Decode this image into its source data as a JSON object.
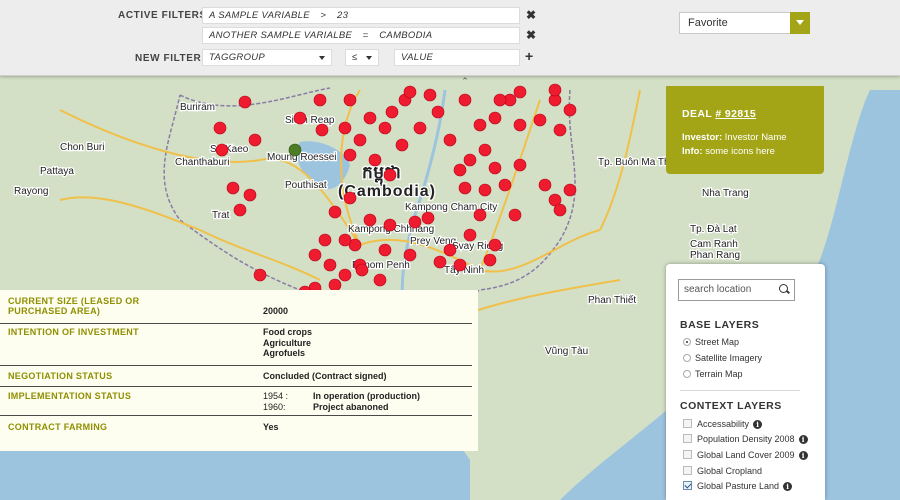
{
  "filters": {
    "active_label": "ACTIVE FILTERS",
    "new_label": "NEW FILTER",
    "active": [
      {
        "variable": "A SAMPLE VARIABLE",
        "operator": ">",
        "value": "23"
      },
      {
        "variable": "ANOTHER SAMPLE VARIALBE",
        "operator": "=",
        "value": "CAMBODIA"
      }
    ],
    "new": {
      "variable": "TAGGROUP",
      "operator": "≤",
      "value": "VALUE"
    },
    "remove_symbol": "✖",
    "add_symbol": "+",
    "collapse_symbol": "⌃"
  },
  "favorite": {
    "selected": "Favorite"
  },
  "deal": {
    "title_prefix": "DEAL",
    "number": "# 92815",
    "investor_label": "Investor:",
    "investor_value": "Investor Name",
    "info_label": "Info:",
    "info_value": "some icons here"
  },
  "details": [
    {
      "key": "CURRENT SIZE (LEASED OR PURCHASED AREA)",
      "values": [
        "20000"
      ]
    },
    {
      "key": "INTENTION OF INVESTMENT",
      "values": [
        "Food crops",
        "Agriculture",
        "Agrofuels"
      ]
    },
    {
      "key": "NEGOTIATION STATUS",
      "values": [
        "Concluded (Contract signed)"
      ]
    },
    {
      "key": "IMPLEMENTATION STATUS",
      "timeline": [
        {
          "year": "1954 :",
          "status": "In operation (production)"
        },
        {
          "year": "1960:",
          "status": "Project abanoned"
        }
      ]
    },
    {
      "key": "CONTRACT FARMING",
      "values": [
        "Yes"
      ]
    }
  ],
  "layers": {
    "search_placeholder": "search location",
    "base_title": "BASE LAYERS",
    "base": [
      {
        "label": "Street Map",
        "selected": true
      },
      {
        "label": "Satellite Imagery",
        "selected": false
      },
      {
        "label": "Terrain Map",
        "selected": false
      }
    ],
    "context_title": "CONTEXT LAYERS",
    "context": [
      {
        "label": "Accessability",
        "checked": false
      },
      {
        "label": "Population Density 2008",
        "checked": false
      },
      {
        "label": "Global Land Cover 2009",
        "checked": false
      },
      {
        "label": "Global Cropland",
        "checked": false
      },
      {
        "label": "Global Pasture Land",
        "checked": true
      }
    ],
    "info_glyph": "i"
  },
  "map": {
    "colors": {
      "land": "#d3e0c6",
      "water": "#9dc4df",
      "marker": "#ee1c2e",
      "selected_marker": "#4f7d25",
      "road": "#f0c04a",
      "border": "#8a7aa6"
    },
    "labels": {
      "country_native": "កម្ពុជា",
      "country": "(Cambodia)",
      "places": [
        "Siem Reap",
        "Moung Roessei",
        "Chanthaburi",
        "Rayong",
        "Trat",
        "Pouthisat",
        "Kampong Chhnang",
        "Kampong Cham City",
        "Prey Veng",
        "Svay Rieng",
        "Tây Ninh",
        "Phnom Penh",
        "Tp. Buôn Ma Thuột",
        "Tp. Đà Lạt",
        "Nha Trang",
        "Phan Rang",
        "Cam Ranh",
        "Phan Thiết",
        "Vũng Tàu",
        "Chon Buri",
        "Pattaya",
        "Sa Kaeo",
        "Buriram"
      ]
    },
    "markers": [
      [
        -34,
        -5,
        1.7
      ],
      [
        -34,
        -5,
        1.8
      ],
      [
        -34,
        -5,
        1.9
      ],
      [
        -34,
        -5,
        2.0
      ],
      [
        -34,
        -5,
        2.1
      ],
      [
        -33,
        -5,
        0
      ],
      [
        -34,
        -4,
        0
      ]
    ]
  }
}
